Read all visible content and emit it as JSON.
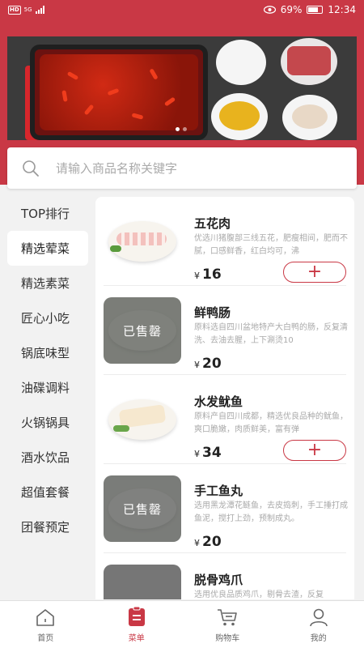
{
  "status_bar": {
    "network": "5G",
    "battery": "69%",
    "time": "12:34"
  },
  "search": {
    "placeholder": "请输入商品名称关键字"
  },
  "sidebar": {
    "items": [
      {
        "label": "TOP排行"
      },
      {
        "label": "精选荤菜"
      },
      {
        "label": "精选素菜"
      },
      {
        "label": "匠心小吃"
      },
      {
        "label": "锅底味型"
      },
      {
        "label": "油碟调料"
      },
      {
        "label": "火锅锅具"
      },
      {
        "label": "酒水饮品"
      },
      {
        "label": "超值套餐"
      },
      {
        "label": "团餐预定"
      }
    ],
    "active_index": 1
  },
  "products": [
    {
      "name": "五花肉",
      "desc": "优选川猪腹部三线五花，肥瘦相间，肥而不腻，口感鲜香，红白均可，沸",
      "currency": "¥",
      "price": "16",
      "sold_out": false
    },
    {
      "name": "鲜鸭肠",
      "desc": "原料选自四川盆地特产大白鸭的肠，反复清洗、去油去腥，上下涮烫10",
      "currency": "¥",
      "price": "20",
      "sold_out": true,
      "sold_out_label": "已售罄"
    },
    {
      "name": "水发鱿鱼",
      "desc": "原料产自四川成都，精选优良品种的鱿鱼，爽口脆嫩，肉质鲜美，富有弹",
      "currency": "¥",
      "price": "34",
      "sold_out": false
    },
    {
      "name": "手工鱼丸",
      "desc": "选用黑龙潭花鲢鱼，去皮捣刺，手工捶打成鱼泥，搅打上劲，预制成丸。",
      "currency": "¥",
      "price": "20",
      "sold_out": true,
      "sold_out_label": "已售罄"
    },
    {
      "name": "脱骨鸡爪",
      "desc": "选用优良品质鸡爪，剔骨去渣，反复",
      "currency": "¥",
      "price": "",
      "sold_out": true,
      "sold_out_label": ""
    }
  ],
  "add_button": {
    "symbol": "+"
  },
  "tabbar": {
    "items": [
      {
        "label": "首页",
        "icon": "home-icon"
      },
      {
        "label": "菜单",
        "icon": "menu-icon"
      },
      {
        "label": "购物车",
        "icon": "cart-icon"
      },
      {
        "label": "我的",
        "icon": "profile-icon"
      }
    ],
    "active_index": 1
  },
  "colors": {
    "brand": "#c93845",
    "background": "#f2f2f2"
  }
}
